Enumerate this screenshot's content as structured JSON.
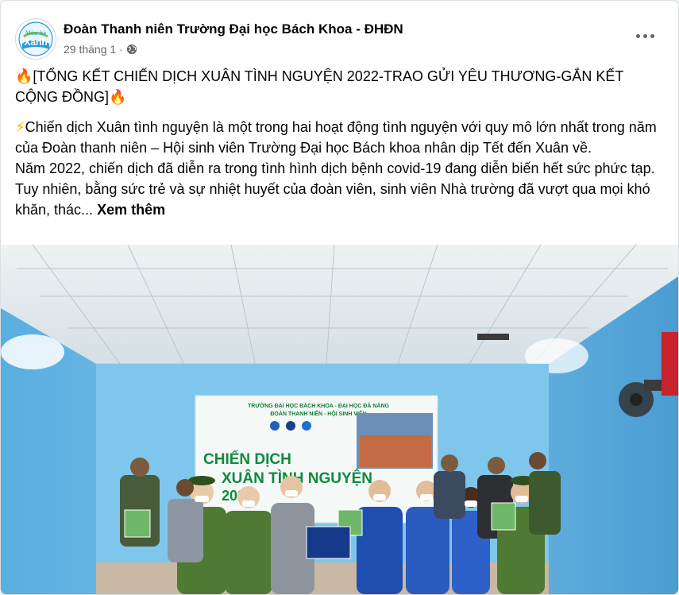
{
  "post": {
    "page_name": "Đoàn Thanh niên Trường Đại học Bách Khoa - ĐHĐN",
    "avatar_text": "Mùa hè Xanh",
    "date": "29 tháng 1",
    "date_separator": "·",
    "more_icon": "more-horizontal-icon",
    "privacy_icon": "globe-icon",
    "title_line": "[TỔNG KẾT CHIẾN DỊCH XUÂN TÌNH NGUYỆN 2022-TRAO GỬI YÊU THƯƠNG-GẮN KẾT CỘNG ĐỒNG]",
    "paragraph1": "Chiến dịch Xuân tình nguyện là một trong hai hoạt động tình nguyện với quy mô lớn nhất trong năm của Đoàn thanh niên – Hội sinh viên Trường Đại học Bách khoa nhân dịp Tết đến Xuân về.",
    "paragraph2": "Năm 2022, chiến dịch đã diễn ra trong tình hình dịch bệnh covid-19 đang diễn biến hết sức phức tạp. Tuy nhiên, bằng sức trẻ và sự nhiệt huyết của đoàn viên, sinh viên Nhà trường đã vượt qua mọi khó khăn, thác...",
    "see_more": "Xem thêm"
  },
  "photo": {
    "banner_line1": "TRƯỜNG ĐẠI HỌC BÁCH KHOA - ĐẠI HỌC ĐÀ NẴNG",
    "banner_line2": "ĐOÀN THANH NIÊN - HỘI SINH VIÊN",
    "banner_title1": "CHIẾN DỊCH",
    "banner_title2": "XUÂN TÌNH NGUYỆN",
    "banner_year": "2022"
  },
  "colors": {
    "text_primary": "#050505",
    "text_secondary": "#65676b",
    "wall_blue": "#4fa3d6",
    "police_green": "#4e7a34",
    "youth_blue": "#1f4fb0"
  }
}
